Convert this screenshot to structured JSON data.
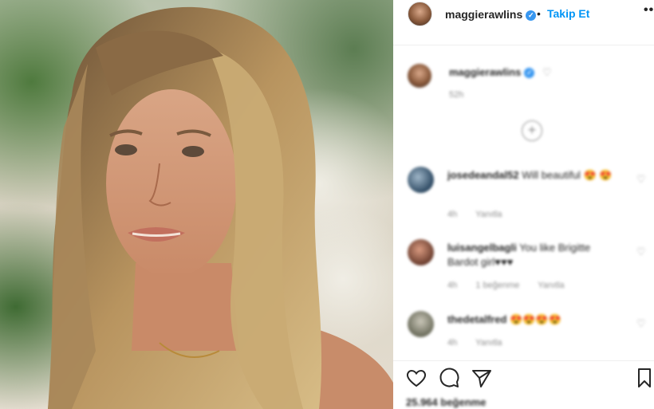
{
  "header": {
    "username": "maggierawlins",
    "verified_mark": "✓",
    "separator": "•",
    "follow_label": "Takip Et",
    "more_label": "•••"
  },
  "caption": {
    "username": "maggierawlins",
    "time": "52h"
  },
  "load_more_label": "+",
  "comments": [
    {
      "username": "josedeandal52",
      "text": "Will beautiful 😍 😍",
      "time": "4h",
      "reply": "Yanıtla",
      "likes": ""
    },
    {
      "username": "luisangelbagli",
      "text": "You like Brigitte Bardot girl♥♥♥",
      "time": "4h",
      "likes": "1 beğenme",
      "reply": "Yanıtla"
    },
    {
      "username": "thedetalfred",
      "text": "😍😍😍😍",
      "time": "4h",
      "reply": "Yanıtla",
      "likes": ""
    }
  ],
  "likes_count": "25.964 beğenme",
  "icons": {
    "like": "heart-icon",
    "comment": "comment-icon",
    "share": "send-icon",
    "save": "bookmark-icon",
    "options": "more-icon"
  },
  "colors": {
    "accent": "#0095f6",
    "verified": "#3897f0",
    "muted": "#8e8e8e",
    "text": "#262626"
  }
}
